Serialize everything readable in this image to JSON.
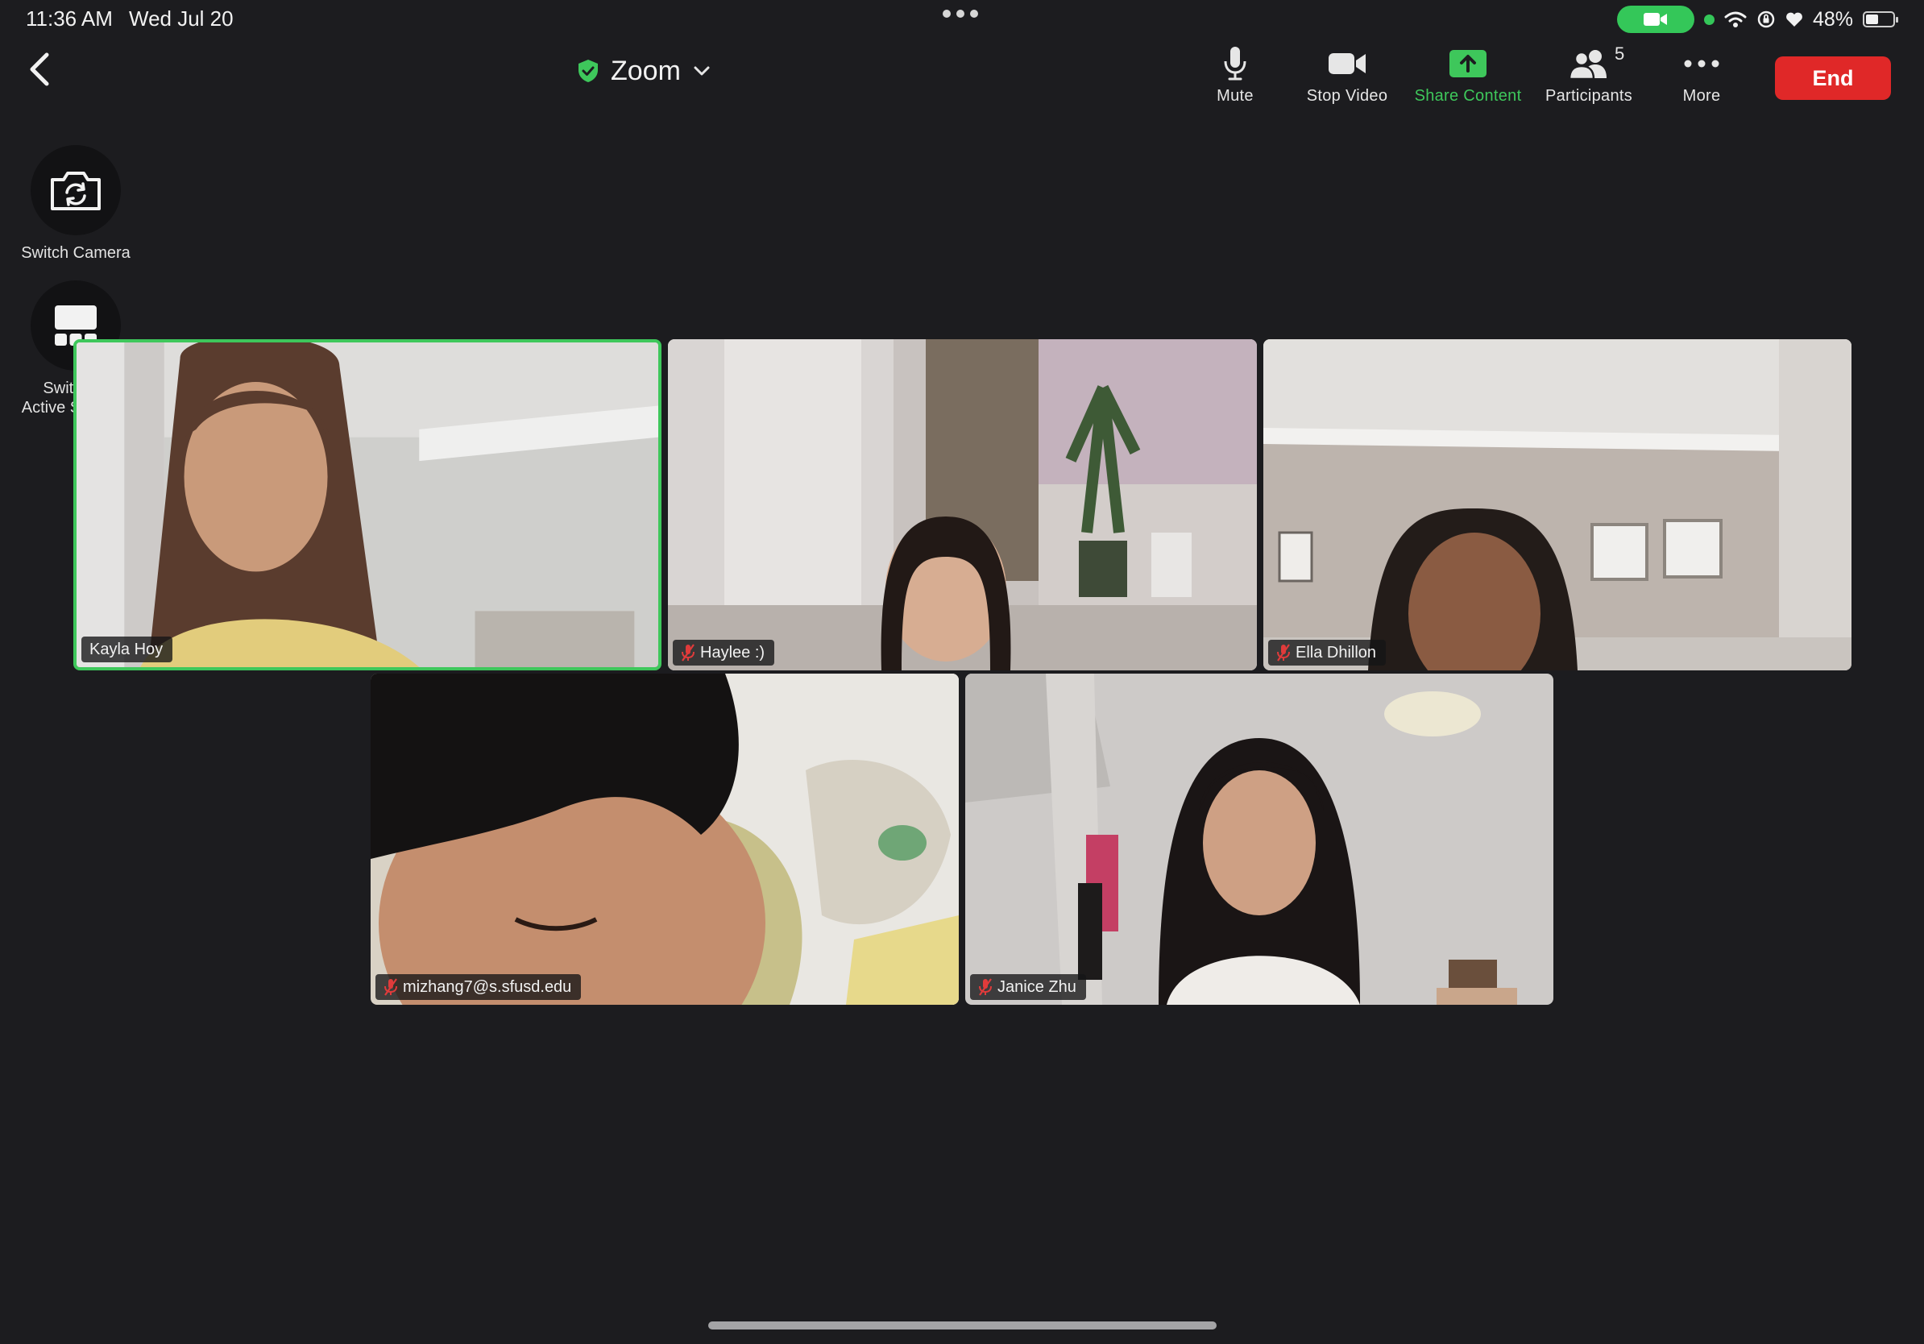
{
  "status_bar": {
    "time": "11:36 AM",
    "date": "Wed Jul 20",
    "battery": "48%",
    "battery_level": 0.48,
    "icons": [
      "camera-in-use-icon",
      "wifi-icon",
      "orientation-lock-icon",
      "heart-icon",
      "battery-icon"
    ]
  },
  "header": {
    "meeting_title": "Zoom",
    "secure_icon": "shield-check-icon",
    "dropdown_icon": "chevron-down-icon"
  },
  "toolbar": {
    "mute": "Mute",
    "stop_video": "Stop Video",
    "share_content": "Share Content",
    "participants": "Participants",
    "participants_count": "5",
    "more": "More",
    "end": "End"
  },
  "side_controls": {
    "switch_camera": "Switch Camera",
    "switch_active_speaker": "Switch to Active Speaker"
  },
  "participants": [
    {
      "name": "Kayla Hoy",
      "muted": false,
      "active_speaker": true
    },
    {
      "name": "Haylee :)",
      "muted": true,
      "active_speaker": false
    },
    {
      "name": "Ella Dhillon",
      "muted": true,
      "active_speaker": false
    },
    {
      "name": "mizhang7@s.sfusd.edu",
      "muted": true,
      "active_speaker": false
    },
    {
      "name": "Janice Zhu",
      "muted": true,
      "active_speaker": false
    }
  ],
  "colors": {
    "background": "#1c1c1f",
    "accent_green": "#3ec75b",
    "end_red": "#e02828"
  }
}
